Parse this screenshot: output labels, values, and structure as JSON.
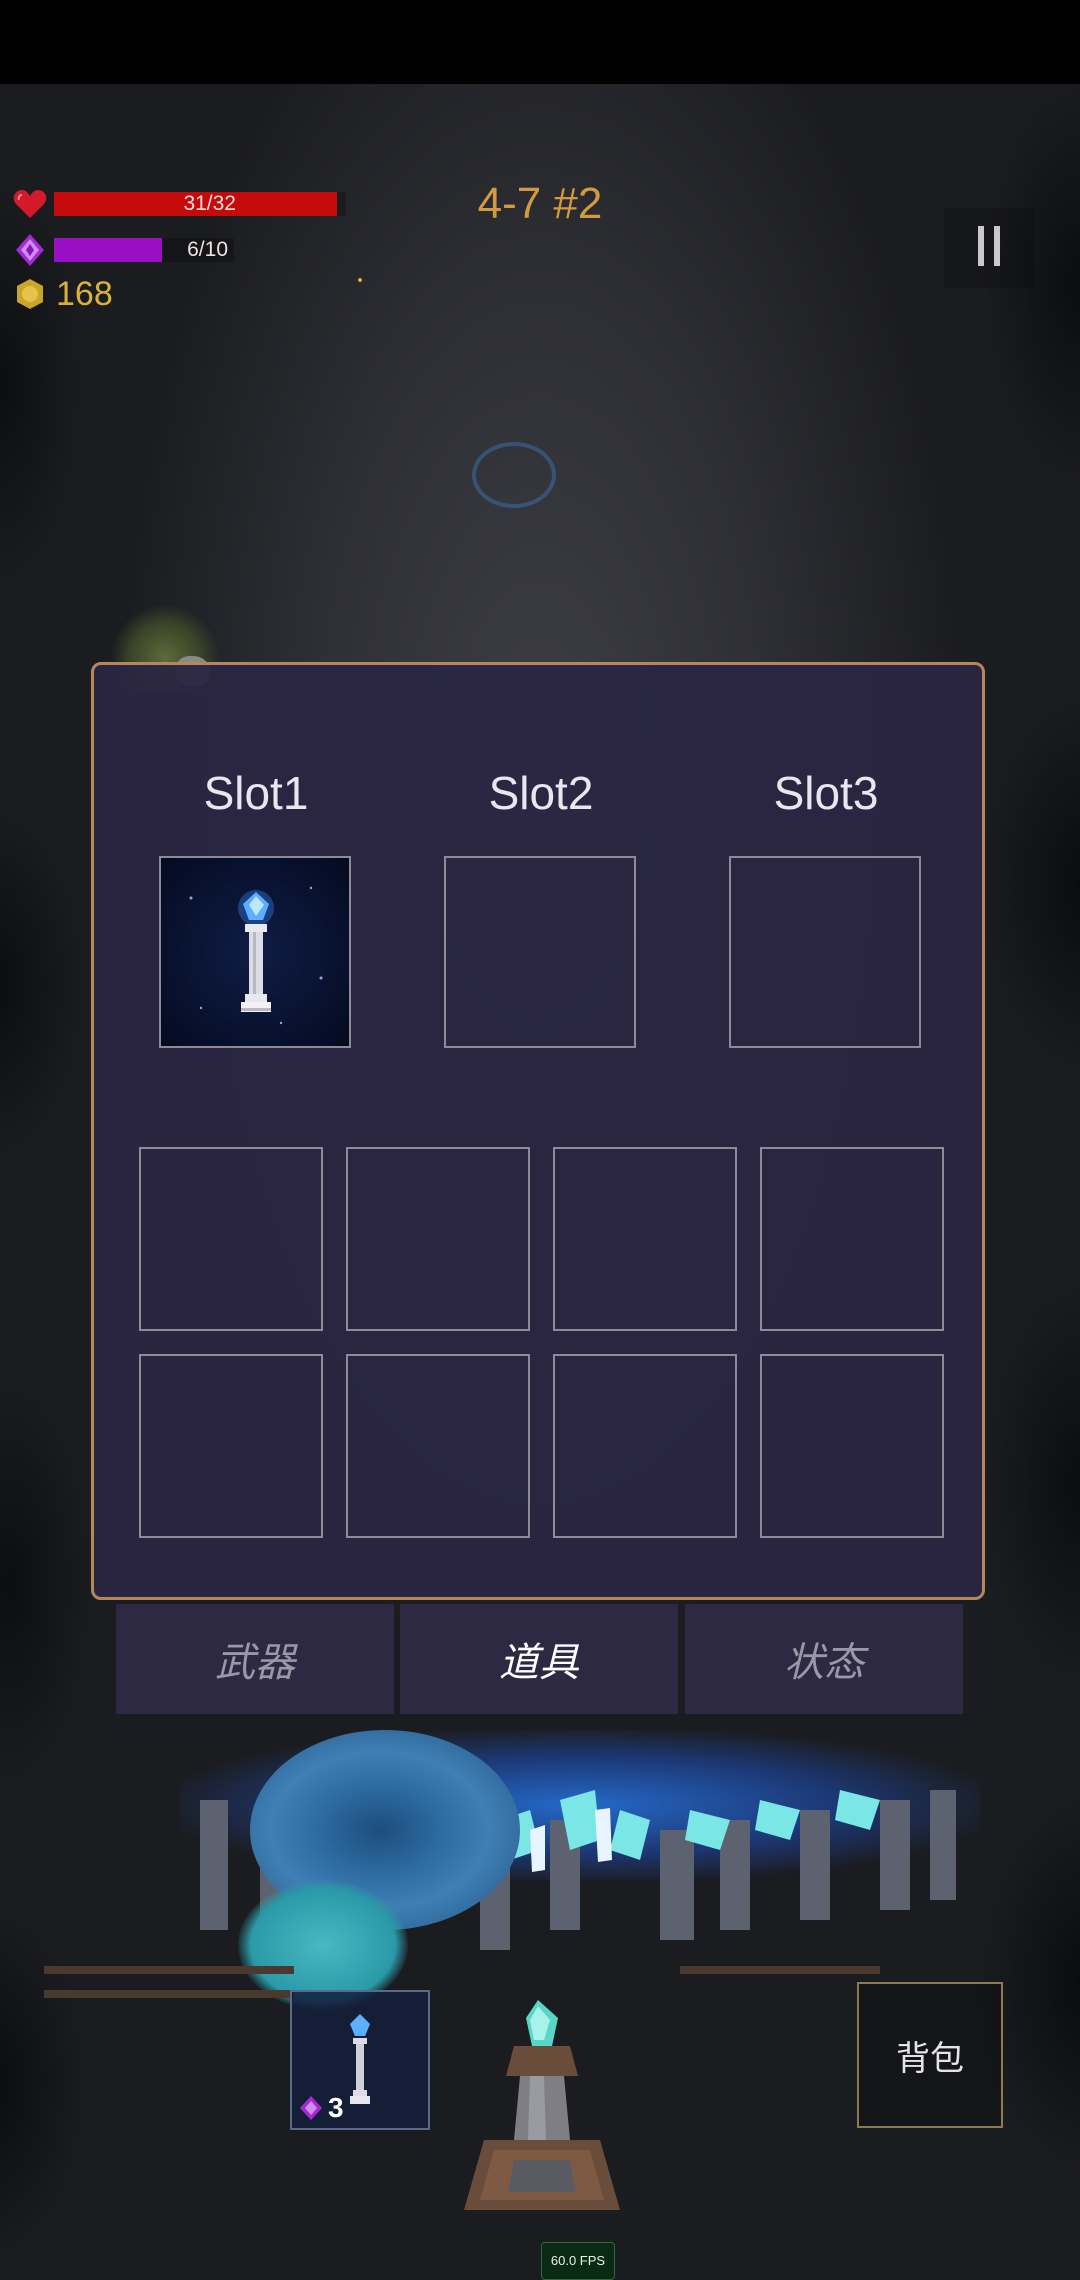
{
  "hud": {
    "hp_text": "31/32",
    "hp_fraction": 0.97,
    "mp_text": "6/10",
    "mp_fraction": 0.6,
    "gold": "168",
    "level": "4-7 #2",
    "colors": {
      "hp": "#c40a0a",
      "mp": "#9a0fc4",
      "gold": "#d9b23a",
      "level": "#d29a3e"
    }
  },
  "panel": {
    "slots": [
      {
        "label": "Slot1",
        "item": "crystal-pillar-tower"
      },
      {
        "label": "Slot2",
        "item": ""
      },
      {
        "label": "Slot3",
        "item": ""
      }
    ],
    "border_color": "#b5875a"
  },
  "tabs": [
    {
      "label": "武器",
      "active": false
    },
    {
      "label": "道具",
      "active": true
    },
    {
      "label": "状态",
      "active": false
    }
  ],
  "hand_item": {
    "icon": "crystal-pillar-tower",
    "cost": "3"
  },
  "bag_label": "背包",
  "fps_text": "60.0 FPS"
}
